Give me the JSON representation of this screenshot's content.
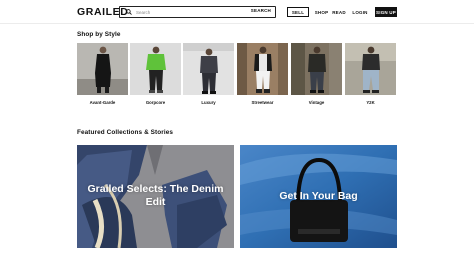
{
  "header": {
    "logo": "GRAILED",
    "search_placeholder": "Search",
    "search_button": "SEARCH",
    "sell": "SELL",
    "shop": "SHOP",
    "read": "READ",
    "login": "LOGIN",
    "signup": "SIGN UP"
  },
  "shop_by_style": {
    "title": "Shop by Style",
    "items": [
      {
        "label": "Avant-Garde"
      },
      {
        "label": "Gorpcore"
      },
      {
        "label": "Luxury"
      },
      {
        "label": "Streetwear"
      },
      {
        "label": "Vintage"
      },
      {
        "label": "Y2K"
      }
    ]
  },
  "featured": {
    "title": "Featured Collections & Stories",
    "cards": [
      {
        "label": "Grailed Selects: The Denim Edit"
      },
      {
        "label": "Get In Your Bag"
      }
    ]
  },
  "colors": {
    "brand": "#111111",
    "signup_bg": "#111111",
    "denim_bg": "#8e8e92",
    "bag_bg": "#2f6fb3"
  },
  "icons": {
    "search": "search-icon"
  }
}
